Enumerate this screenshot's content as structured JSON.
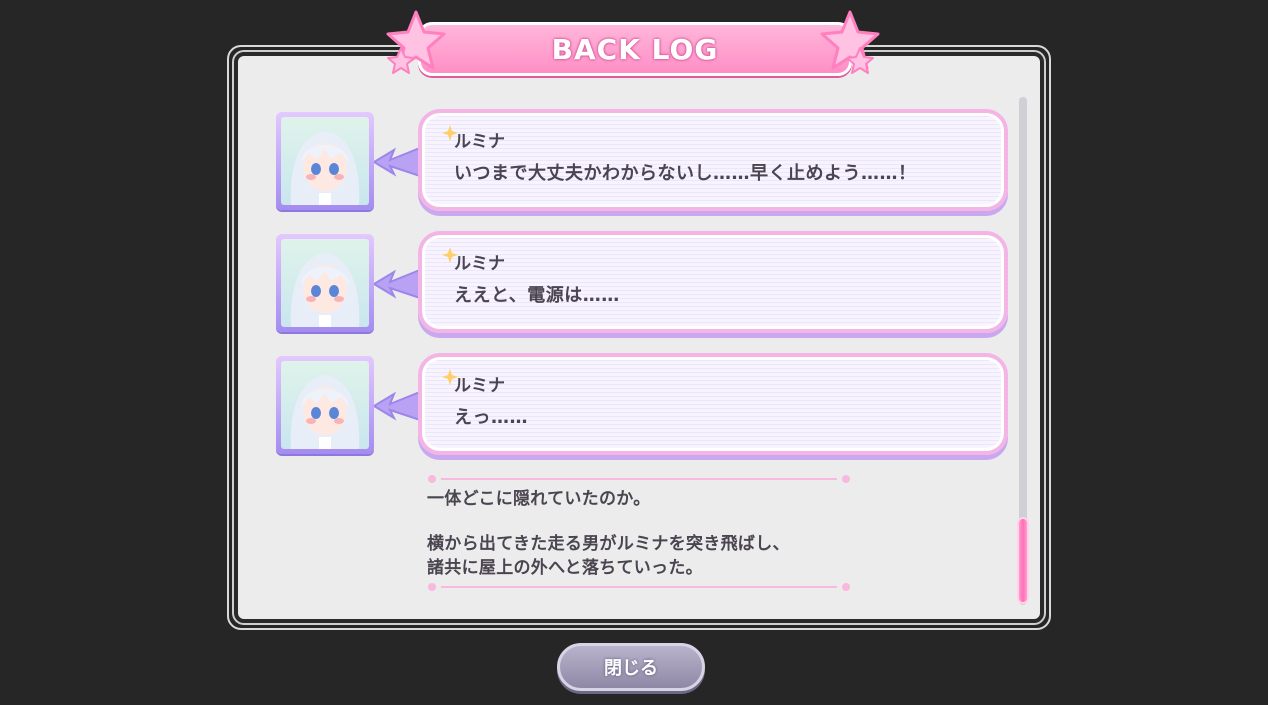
{
  "title": "BACK LOG",
  "entries": [
    {
      "speaker": "ルミナ",
      "text": "いつまで大丈夫かわからないし……早く止めよう……！",
      "portrait_icon": "lumina-portrait"
    },
    {
      "speaker": "ルミナ",
      "text": "ええと、電源は……",
      "portrait_icon": "lumina-portrait"
    },
    {
      "speaker": "ルミナ",
      "text": "えっ……",
      "portrait_icon": "lumina-portrait"
    }
  ],
  "narration": [
    "一体どこに隠れていたのか。",
    "横から出てきた走る男がルミナを突き飛ばし、",
    "諸共に屋上の外へと落ちていった。"
  ],
  "close_label": "閉じる",
  "scroll": {
    "position": 1.0
  },
  "colors": {
    "accent_pink": "#ff8fc6",
    "accent_purple": "#a48cf0",
    "text": "#4a4550",
    "background": "#262626"
  }
}
